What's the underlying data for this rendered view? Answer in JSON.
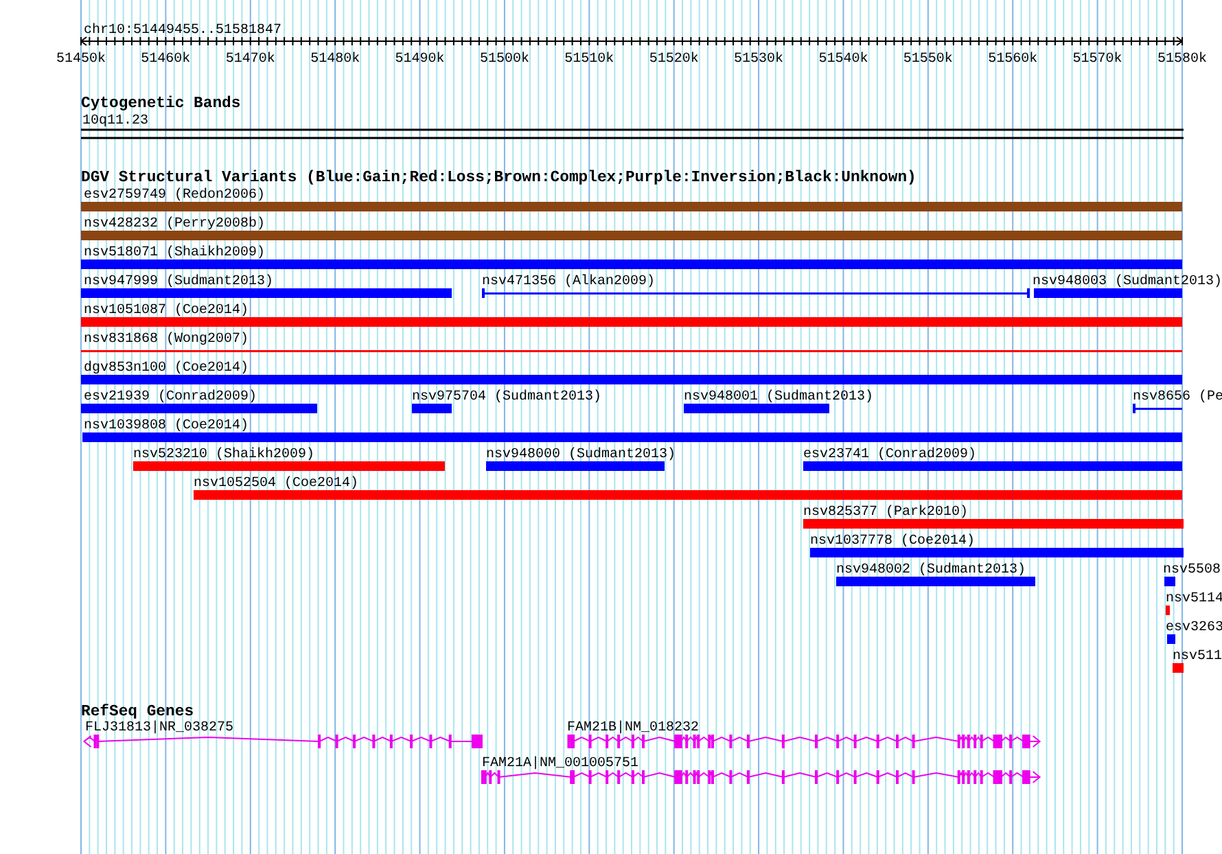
{
  "ruler": {
    "location": "chr10:51449455..51581847",
    "ticks": [
      "51450k",
      "51460k",
      "51470k",
      "51480k",
      "51490k",
      "51500k",
      "51510k",
      "51520k",
      "51530k",
      "51540k",
      "51550k",
      "51560k",
      "51570k",
      "51580k"
    ]
  },
  "cytobands": {
    "title": "Cytogenetic Bands",
    "band": "10q11.23"
  },
  "variants": {
    "title": "DGV Structural Variants (Blue:Gain;Red:Loss;Brown:Complex;Purple:Inversion;Black:Unknown)",
    "features": [
      {
        "label": "esv2759749 (Redon2006)",
        "color": "#8b4513",
        "kind": "bar"
      },
      {
        "label": "nsv428232 (Perry2008b)",
        "color": "#8b4513",
        "kind": "bar"
      },
      {
        "label": "nsv518071 (Shaikh2009)",
        "color": "#0000ff",
        "kind": "bar"
      },
      {
        "label": "nsv947999 (Sudmant2013)",
        "color": "#0000ff",
        "kind": "bar"
      },
      {
        "label": "nsv471356 (Alkan2009)",
        "color": "#0000ff",
        "kind": "line"
      },
      {
        "label": "nsv948003 (Sudmant2013)",
        "color": "#0000ff",
        "kind": "bar"
      },
      {
        "label": "nsv1051087 (Coe2014)",
        "color": "#ff0000",
        "kind": "bar"
      },
      {
        "label": "nsv831868 (Wong2007)",
        "color": "#ff0000",
        "kind": "line"
      },
      {
        "label": "dgv853n100 (Coe2014)",
        "color": "#0000ff",
        "kind": "bar"
      },
      {
        "label": "esv21939 (Conrad2009)",
        "color": "#0000ff",
        "kind": "bar"
      },
      {
        "label": "nsv975704 (Sudmant2013)",
        "color": "#0000ff",
        "kind": "bar"
      },
      {
        "label": "nsv948001 (Sudmant2013)",
        "color": "#0000ff",
        "kind": "bar"
      },
      {
        "label": "nsv8656 (Pe",
        "color": "#0000ff",
        "kind": "line"
      },
      {
        "label": "nsv1039808 (Coe2014)",
        "color": "#0000ff",
        "kind": "bar"
      },
      {
        "label": "nsv523210 (Shaikh2009)",
        "color": "#ff0000",
        "kind": "bar"
      },
      {
        "label": "nsv948000 (Sudmant2013)",
        "color": "#0000ff",
        "kind": "bar"
      },
      {
        "label": "esv23741 (Conrad2009)",
        "color": "#0000ff",
        "kind": "bar"
      },
      {
        "label": "nsv1052504 (Coe2014)",
        "color": "#ff0000",
        "kind": "bar"
      },
      {
        "label": "nsv825377 (Park2010)",
        "color": "#ff0000",
        "kind": "bar"
      },
      {
        "label": "nsv1037778 (Coe2014)",
        "color": "#0000ff",
        "kind": "bar"
      },
      {
        "label": "nsv948002 (Sudmant2013)",
        "color": "#0000ff",
        "kind": "bar"
      },
      {
        "label": "nsv5508",
        "color": "#0000ff",
        "kind": "bar"
      },
      {
        "label": "nsv5114",
        "color": "#ff0000",
        "kind": "bar"
      },
      {
        "label": "esv3263",
        "color": "#0000ff",
        "kind": "bar"
      },
      {
        "label": "nsv511",
        "color": "#ff0000",
        "kind": "bar"
      }
    ]
  },
  "genes": {
    "title": "RefSeq Genes",
    "features": [
      {
        "label": "FLJ31813|NR_038275",
        "reverse": true
      },
      {
        "label": "FAM21B|NM_018232",
        "reverse": false
      },
      {
        "label": "FAM21A|NM_001005751",
        "reverse": false
      }
    ]
  }
}
